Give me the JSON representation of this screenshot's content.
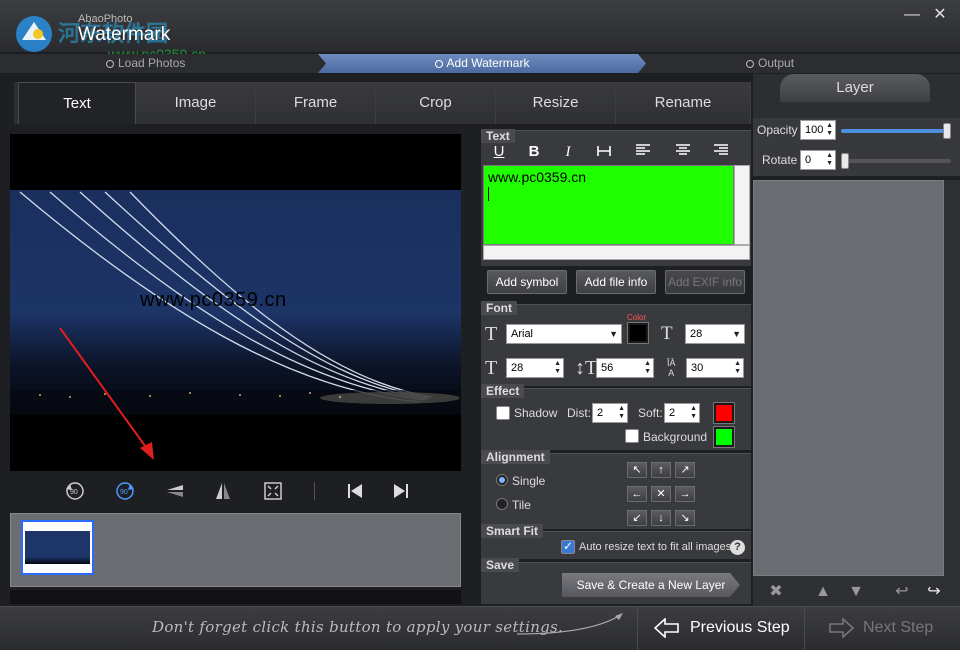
{
  "app": {
    "subtitle": "AbaoPhoto",
    "title": "Watermark",
    "overlay_text": "河东软件园",
    "overlay_url": "www.pc0359.cn"
  },
  "window": {
    "minimize_icon": "minimize-icon",
    "close_icon": "close-icon"
  },
  "steps": [
    {
      "label": "Load Photos",
      "state": "done"
    },
    {
      "label": "Add Watermark",
      "state": "active"
    },
    {
      "label": "Output",
      "state": "pending"
    }
  ],
  "tabs": [
    {
      "label": "Text",
      "active": true
    },
    {
      "label": "Image"
    },
    {
      "label": "Frame"
    },
    {
      "label": "Crop"
    },
    {
      "label": "Resize"
    },
    {
      "label": "Rename"
    }
  ],
  "preview": {
    "watermark_text": "www.pc0359.cn"
  },
  "text_section": {
    "label": "Text",
    "format_buttons": [
      "U",
      "B",
      "I",
      "strikethrough",
      "align-left",
      "align-center",
      "align-right"
    ],
    "content": "www.pc0359.cn",
    "content_bg": "#1fff00",
    "add_symbol": "Add symbol",
    "add_file_info": "Add file info",
    "add_exif_info": "Add EXIF info"
  },
  "font_section": {
    "label": "Font",
    "family": "Arial",
    "color_label": "Color",
    "color": "#000000",
    "size": "28",
    "width": "28",
    "height": "56",
    "spacing": "30"
  },
  "effect_section": {
    "label": "Effect",
    "shadow_label": "Shadow",
    "dist_label": "Dist:",
    "dist": "2",
    "soft_label": "Soft:",
    "soft": "2",
    "shadow_color": "#ff0000",
    "background_label": "Background",
    "background_color": "#00ff00"
  },
  "alignment_section": {
    "label": "Alignment",
    "single_label": "Single",
    "tile_label": "Tile",
    "grid": [
      "↖",
      "↑",
      "↗",
      "←",
      "✕",
      "→",
      "↙",
      "↓",
      "↘"
    ]
  },
  "smart_fit": {
    "label": "Smart Fit",
    "auto_resize_label": "Auto resize text to fit all images.",
    "help": "?"
  },
  "save_section": {
    "label": "Save",
    "button": "Save & Create a New Layer"
  },
  "layer_panel": {
    "title": "Layer",
    "opacity_label": "Opacity",
    "opacity": "100",
    "rotate_label": "Rotate",
    "rotate": "0",
    "opacity_level": 1.0,
    "rotate_level": 0.0
  },
  "bottom": {
    "hint": "Don't forget click this button to apply your settings.",
    "previous": "Previous Step",
    "next": "Next Step"
  }
}
